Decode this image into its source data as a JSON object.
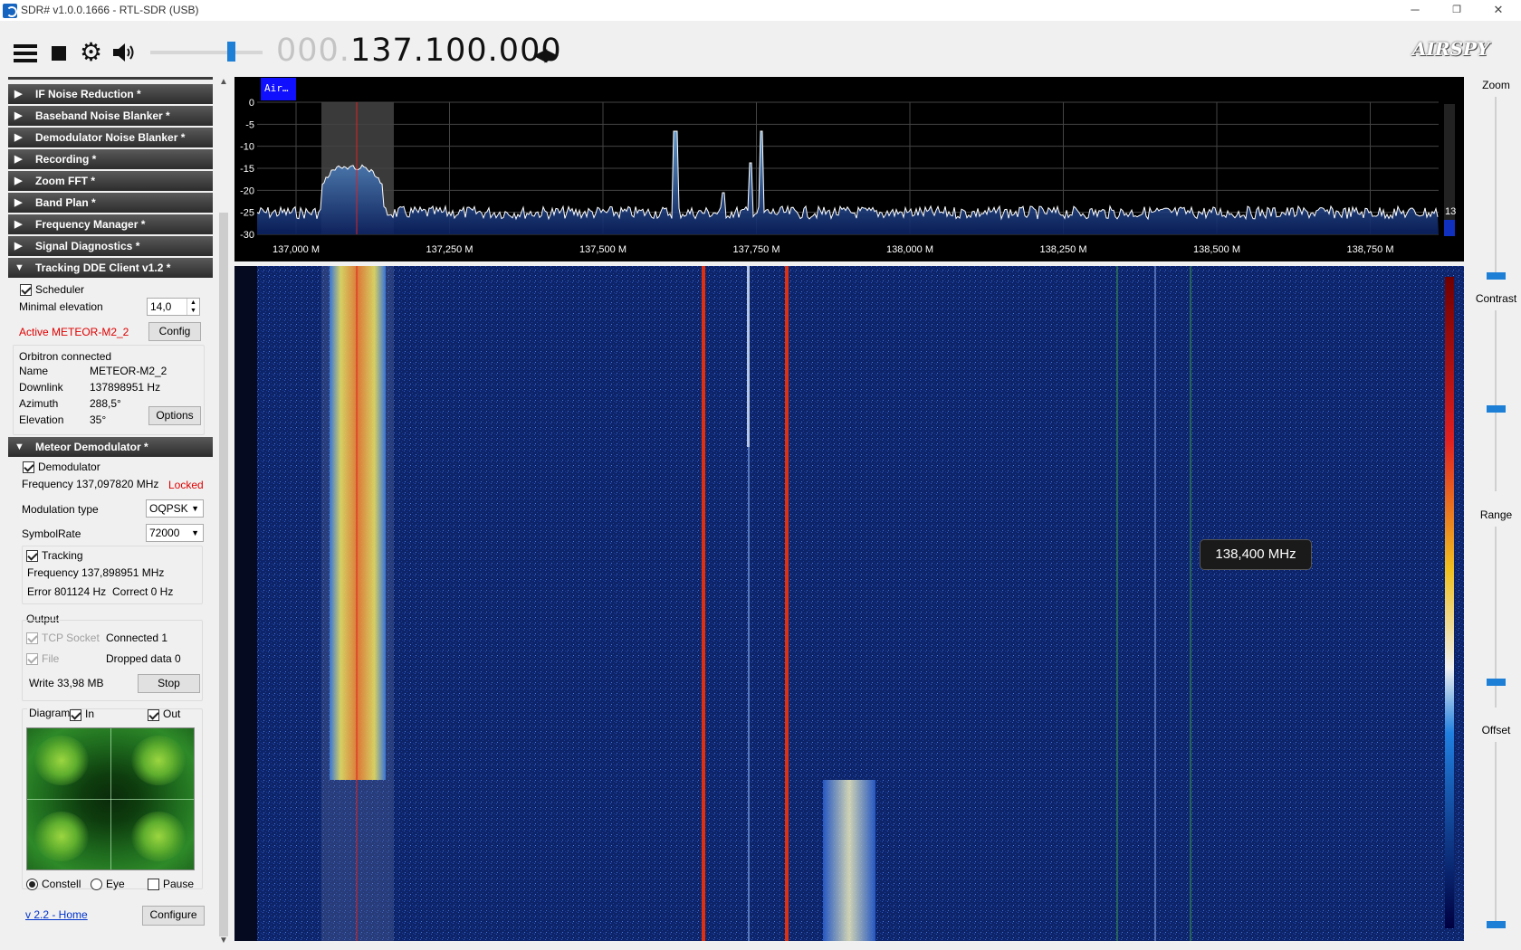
{
  "window": {
    "title": "SDR# v1.0.0.1666 - RTL-SDR (USB)",
    "minimize": "─",
    "restore": "❐",
    "close": "✕"
  },
  "toolbar": {
    "frequency_lead": "000.",
    "frequency_main": "137.100.000",
    "tune_arrows": "◀▶",
    "volume_percent": 62,
    "brand_logo": "AIRSPY"
  },
  "sidebar": {
    "panels_top": [
      {
        "label": "IF Noise Reduction *",
        "state": "collapsed"
      },
      {
        "label": "Baseband Noise Blanker *",
        "state": "collapsed"
      },
      {
        "label": "Demodulator Noise Blanker *",
        "state": "collapsed"
      },
      {
        "label": "Recording *",
        "state": "collapsed"
      },
      {
        "label": "Zoom FFT *",
        "state": "collapsed"
      },
      {
        "label": "Band Plan *",
        "state": "collapsed"
      },
      {
        "label": "Frequency Manager *",
        "state": "collapsed"
      },
      {
        "label": "Signal Diagnostics *",
        "state": "collapsed"
      },
      {
        "label": "Tracking DDE Client v1.2 *",
        "state": "expanded"
      }
    ],
    "tracking": {
      "scheduler_label": "Scheduler",
      "scheduler_checked": true,
      "min_elevation_label": "Minimal elevation",
      "min_elevation_value": "14,0",
      "active_label": "Active METEOR-M2_2",
      "config_button": "Config",
      "orbitron_label": "Orbitron connected",
      "name_label": "Name",
      "name_value": "METEOR-M2_2",
      "downlink_label": "Downlink",
      "downlink_value": "137898951 Hz",
      "azimuth_label": "Azimuth",
      "azimuth_value": "288,5°",
      "elevation_label": "Elevation",
      "elevation_value": "35°",
      "options_button": "Options"
    },
    "meteor_panel_label": "Meteor Demodulator *",
    "meteor": {
      "demodulator_label": "Demodulator",
      "demodulator_checked": true,
      "frequency_text": "Frequency 137,097820 MHz",
      "locked_text": "Locked",
      "modulation_label": "Modulation type",
      "modulation_value": "OQPSK",
      "symbolrate_label": "SymbolRate",
      "symbolrate_value": "72000",
      "tracking_label": "Tracking",
      "tracking_checked": true,
      "tracking_freq": "Frequency 137,898951 MHz",
      "error_text": "Error 801124 Hz",
      "correct_text": "Correct 0 Hz",
      "output_label": "Output",
      "tcp_label": "TCP Socket",
      "tcp_status": "Connected 1",
      "file_label": "File",
      "file_status": "Dropped data 0",
      "write_text": "Write 33,98 MB",
      "stop_button": "Stop",
      "diagram_label": "Diagram",
      "in_label": "In",
      "out_label": "Out",
      "constell_label": "Constell",
      "eye_label": "Eye",
      "pause_label": "Pause",
      "version_link": "v 2.2 - Home",
      "configure_button": "Configure"
    },
    "scroll_up": "▲",
    "scroll_down": "▼"
  },
  "spectrum": {
    "mode_badge": "Air…",
    "y_ticks": [
      "0",
      "-5",
      "-10",
      "-15",
      "-20",
      "-25",
      "-30"
    ],
    "x_ticks": [
      "137,000 M",
      "137,250 M",
      "137,500 M",
      "137,750 M",
      "138,000 M",
      "138,250 M",
      "138,500 M",
      "138,750 M"
    ],
    "level_label": "13"
  },
  "waterfall": {
    "tooltip": "138,400 MHz"
  },
  "right_panel": {
    "zoom_label": "Zoom",
    "contrast_label": "Contrast",
    "range_label": "Range",
    "offset_label": "Offset"
  },
  "colors": {
    "accent": "#1e7fd6",
    "waterfall_bg": "#0a1a4a",
    "locked": "#e00000"
  }
}
